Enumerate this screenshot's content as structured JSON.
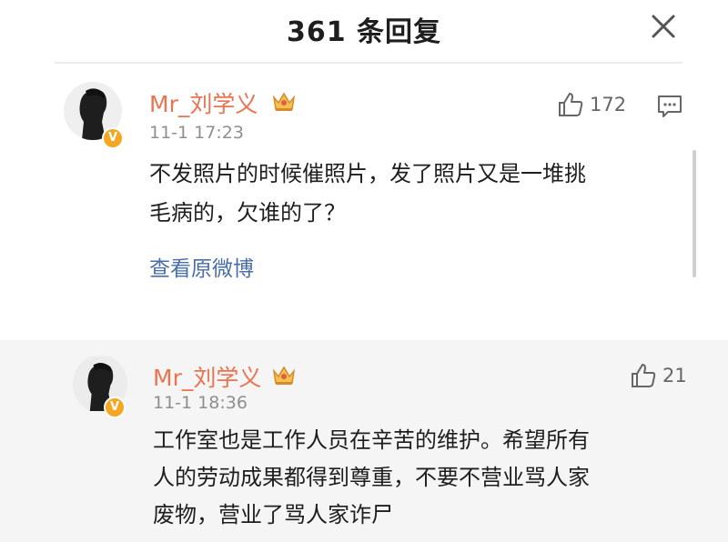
{
  "header": {
    "title": "361 条回复"
  },
  "comments": [
    {
      "username": "Mr_刘学义",
      "timestamp": "11-1 17:23",
      "likes": "172",
      "text_lines": [
        "不发照片的时候催照片，发了照片又是一堆挑",
        "毛病的，欠谁的了？"
      ],
      "link": "查看原微博"
    },
    {
      "username": "Mr_刘学义",
      "timestamp": "11-1 18:36",
      "likes": "21",
      "text_lines": [
        "工作室也是工作人员在辛苦的维护。希望所有",
        "人的劳动成果都得到尊重，不要不营业骂人家",
        "废物，营业了骂人家诈尸"
      ]
    }
  ],
  "colors": {
    "username": "#eb7350",
    "link": "#4a6ea8",
    "badge": "#f5a623",
    "crown": "#e8a33d"
  },
  "icons": {
    "close": "close-icon",
    "like": "thumbs-up-icon",
    "reply": "comment-bubble-icon",
    "crown": "crown-icon",
    "verified": "verified-v-badge"
  }
}
